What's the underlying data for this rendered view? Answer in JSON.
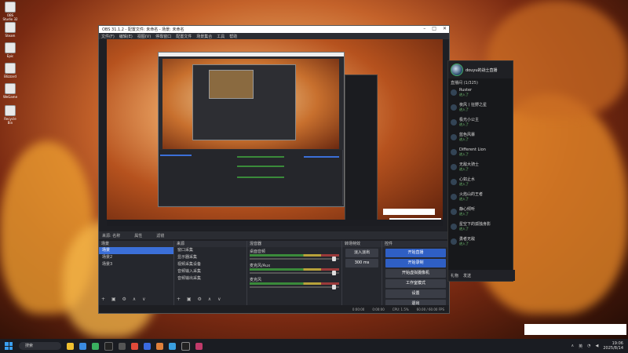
{
  "desktop": {
    "icons": [
      {
        "label": "OBS Studio 32"
      },
      {
        "label": "Steam"
      },
      {
        "label": "Epic"
      },
      {
        "label": "Blizzard"
      },
      {
        "label": "WeGame"
      },
      {
        "label": "Recycle Bin"
      }
    ]
  },
  "obs": {
    "title": "OBS 31.1.2 - 配置文件: 未命名 - 场景: 未命名",
    "menu": [
      "文件(F)",
      "编辑(E)",
      "视图(V)",
      "停靠窗口",
      "配置文件",
      "场景集合",
      "工具",
      "帮助"
    ],
    "scene_bar": {
      "label": "来源: 名称",
      "properties": "属性",
      "filters": "滤镜"
    },
    "scenes": {
      "header": "场景",
      "items": [
        "场景",
        "场景2",
        "场景3"
      ],
      "selected": 0
    },
    "sources": {
      "header": "来源",
      "items": [
        "窗口采集",
        "显示器采集",
        "视频采集设备",
        "音频输入采集",
        "音频输出采集"
      ]
    },
    "mixer": {
      "header": "混音器",
      "channels": [
        {
          "name": "桌面音频",
          "level": 0.7
        },
        {
          "name": "麦克风/Aux",
          "level": 0.8
        },
        {
          "name": "麦克风",
          "level": 0.55
        }
      ]
    },
    "transitions": {
      "header": "转场特效",
      "type": "淡入淡出",
      "duration": "300 ms"
    },
    "controls": {
      "header": "控件",
      "buttons": [
        "开始直播",
        "开始录制",
        "开始虚拟摄像机",
        "工作室模式",
        "设置",
        "退出"
      ]
    },
    "status": {
      "items": [
        "0:00:00",
        "0:00:00",
        "CPU: 1.5%",
        "60.00 / 60.00 FPS"
      ]
    }
  },
  "chat": {
    "channel": "douyu的战士直播",
    "subtitle": "直播间 (1/325)",
    "messages": [
      {
        "user": "Ruster",
        "msg": "进入了"
      },
      {
        "user": "夜风丨狂野之星",
        "msg": "进入了"
      },
      {
        "user": "极光小公主",
        "msg": "进入了"
      },
      {
        "user": "蓝色风暴",
        "msg": "进入了"
      },
      {
        "user": "Different Lion",
        "msg": "进入了"
      },
      {
        "user": "无敌大骑士",
        "msg": "进入了"
      },
      {
        "user": "心如止水",
        "msg": "进入了"
      },
      {
        "user": "火焰山的王者",
        "msg": "进入了"
      },
      {
        "user": "静心倾听",
        "msg": "进入了"
      },
      {
        "user": "星空下的孤独身影",
        "msg": "进入了"
      },
      {
        "user": "勇者无敌",
        "msg": "进入了"
      }
    ],
    "bottom": [
      "礼物",
      "发送"
    ]
  },
  "taskbar": {
    "search_placeholder": "搜索",
    "tray_lang": "英",
    "time": "19:06",
    "date": "2025/8/14"
  },
  "colors": {
    "accent": "#3b6fd8",
    "panel": "#25272d",
    "meter_green": "#3a8a3a"
  }
}
